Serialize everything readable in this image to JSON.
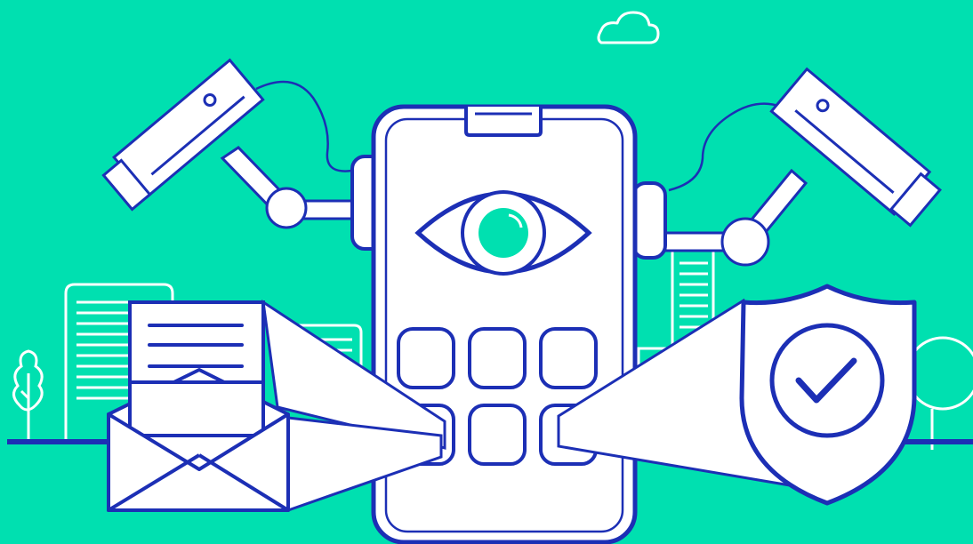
{
  "colors": {
    "background": "#00E0B0",
    "outline": "#1C2FB5",
    "fill": "#FFFFFF",
    "line_light": "#FFFFFF",
    "accent": "#00E0B0"
  },
  "scene": {
    "subject": "phone-surveillance-illustration"
  }
}
